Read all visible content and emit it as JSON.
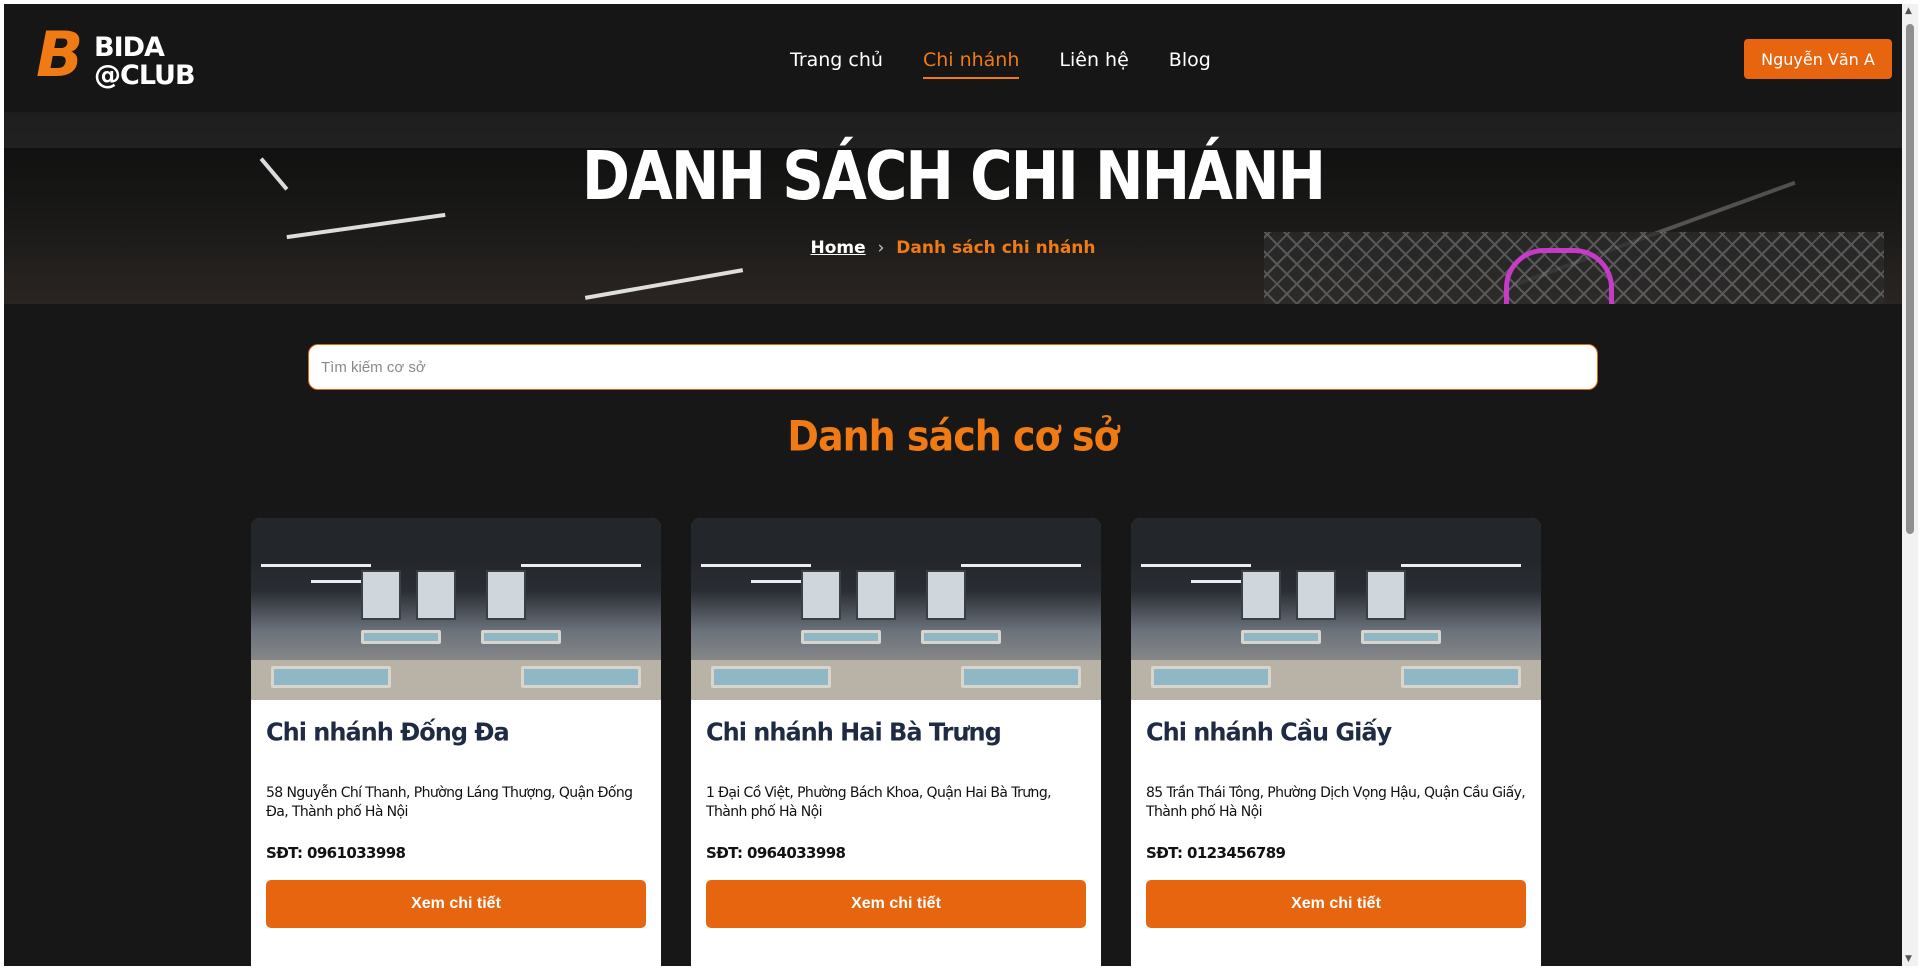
{
  "brand": {
    "logo_letter": "B",
    "logo_word1": "BIDA",
    "logo_word2": "@CLUB"
  },
  "nav": {
    "items": [
      {
        "label": "Trang chủ",
        "active": false
      },
      {
        "label": "Chi nhánh",
        "active": true
      },
      {
        "label": "Liên hệ",
        "active": false
      },
      {
        "label": "Blog",
        "active": false
      }
    ],
    "user_button": "Nguyễn Văn A"
  },
  "hero": {
    "title": "DANH SÁCH CHI NHÁNH",
    "breadcrumb": {
      "home": "Home",
      "separator": "›",
      "current": "Danh sách chi nhánh"
    }
  },
  "search": {
    "placeholder": "Tìm kiếm cơ sở",
    "value": ""
  },
  "section_title": "Danh sách cơ sở",
  "branches": [
    {
      "name": "Chi nhánh Đống Đa",
      "address": "58 Nguyễn Chí Thanh, Phường Láng Thượng, Quận Đống Đa, Thành phố Hà Nội",
      "phone": "SĐT: 0961033998",
      "button": "Xem chi tiết"
    },
    {
      "name": "Chi nhánh Hai Bà Trưng",
      "address": "1 Đại Cồ Việt, Phường Bách Khoa, Quận Hai Bà Trưng, Thành phố Hà Nội",
      "phone": "SĐT: 0964033998",
      "button": "Xem chi tiết"
    },
    {
      "name": "Chi nhánh Cầu Giấy",
      "address": "85 Trần Thái Tông, Phường Dịch Vọng Hậu, Quận Cầu Giấy, Thành phố Hà Nội",
      "phone": "SĐT: 0123456789",
      "button": "Xem chi tiết"
    }
  ],
  "colors": {
    "accent": "#e8650f",
    "background": "#171717",
    "card_title": "#1f2a44"
  },
  "scrollbar": {
    "up_icon": "▲",
    "down_icon": "▼"
  }
}
